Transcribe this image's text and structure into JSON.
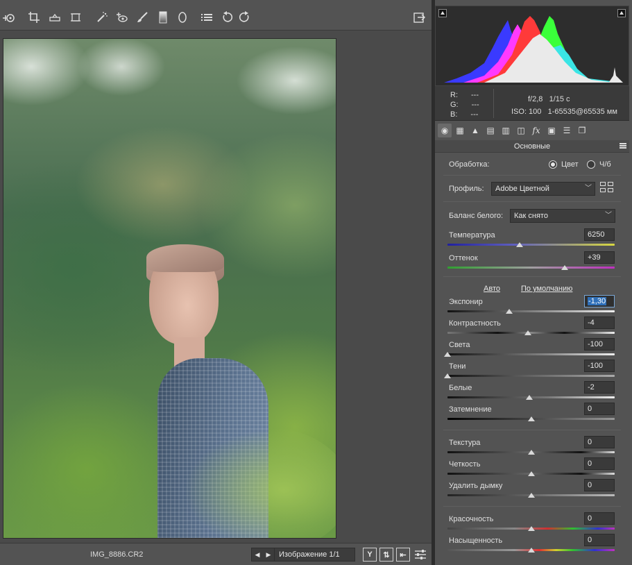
{
  "toolbar": {
    "tools": [
      "zoom-icon",
      "crop-icon",
      "straighten-icon",
      "transform-icon",
      "spot-removal-icon",
      "red-eye-icon",
      "adjustment-brush-icon",
      "graduated-filter-icon",
      "radial-filter-icon",
      "presets-list-icon",
      "rotate-left-icon",
      "rotate-right-icon"
    ],
    "open_object_icon": "export-icon"
  },
  "statusbar": {
    "filename": "IMG_8886.CR2",
    "image_counter": "Изображение 1/1",
    "y_button_label": "Y"
  },
  "histogram": {
    "r_label": "R:",
    "g_label": "G:",
    "b_label": "B:",
    "r_value": "---",
    "g_value": "---",
    "b_value": "---",
    "aperture": "f/2,8",
    "shutter": "1/15 с",
    "iso": "ISO: 100",
    "lens": "1-65535@65535 мм"
  },
  "panel": {
    "title": "Основные",
    "treatment_label": "Обработка:",
    "treatment_color": "Цвет",
    "treatment_bw": "Ч/б",
    "treatment_selected": "color",
    "profile_label": "Профиль:",
    "profile_value": "Adobe Цветной",
    "wb_label": "Баланс белого:",
    "wb_value": "Как снято",
    "auto_link": "Авто",
    "default_link": "По умолчанию"
  },
  "sliders": {
    "temperature": {
      "label": "Температура",
      "value": "6250",
      "position": 0.43
    },
    "tint": {
      "label": "Оттенок",
      "value": "+39",
      "position": 0.7
    },
    "exposure": {
      "label": "Экспонир",
      "value": "-1,30",
      "position": 0.37
    },
    "contrast": {
      "label": "Контрастность",
      "value": "-4",
      "position": 0.48
    },
    "highlights": {
      "label": "Света",
      "value": "-100",
      "position": 0.0
    },
    "shadows": {
      "label": "Тени",
      "value": "-100",
      "position": 0.0
    },
    "whites": {
      "label": "Белые",
      "value": "-2",
      "position": 0.49
    },
    "blacks": {
      "label": "Затемнение",
      "value": "0",
      "position": 0.5
    },
    "texture": {
      "label": "Текстура",
      "value": "0",
      "position": 0.5
    },
    "clarity": {
      "label": "Четкость",
      "value": "0",
      "position": 0.5
    },
    "dehaze": {
      "label": "Удалить дымку",
      "value": "0",
      "position": 0.5
    },
    "vibrance": {
      "label": "Красочность",
      "value": "0",
      "position": 0.5
    },
    "saturation": {
      "label": "Насыщенность",
      "value": "0",
      "position": 0.5
    }
  },
  "colors": {
    "background": "#535353",
    "focus_highlight": "#2e6fb8"
  }
}
